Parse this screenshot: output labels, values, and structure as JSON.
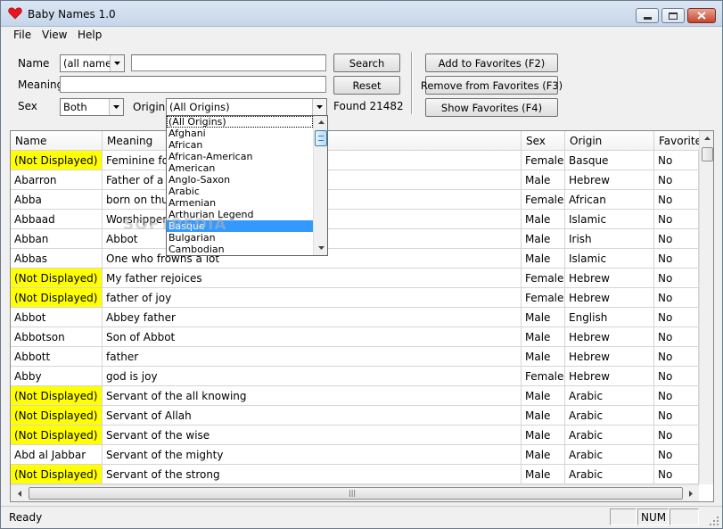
{
  "window": {
    "title": "Baby Names 1.0"
  },
  "menu": {
    "file": "File",
    "view": "View",
    "help": "Help"
  },
  "search": {
    "name_label": "Name",
    "name_mode": "(all names)",
    "name_value": "",
    "meaning_label": "Meaning",
    "meaning_value": "",
    "sex_label": "Sex",
    "sex_value": "Both",
    "origin_label": "Origin",
    "origin_value": "(All Origins)",
    "found_text": "Found 21482",
    "search_button": "Search",
    "reset_button": "Reset"
  },
  "favorites": {
    "add_button": "Add to Favorites (F2)",
    "remove_button": "Remove from Favorites (F3)",
    "show_button": "Show Favorites (F4)"
  },
  "origin_dropdown": {
    "items": [
      "(All Origins)",
      "Afghani",
      "African",
      "African-American",
      "American",
      "Anglo-Saxon",
      "Arabic",
      "Armenian",
      "Arthurian Legend",
      "Basque",
      "Bulgarian",
      "Cambodian"
    ],
    "selected": "Basque"
  },
  "table": {
    "columns": [
      "Name",
      "Meaning",
      "Sex",
      "Origin",
      "Favorite"
    ],
    "rows": [
      {
        "name": "(Not Displayed)",
        "meaning": "Feminine for",
        "sex": "Female",
        "origin": "Basque",
        "favorite": "No",
        "highlight": true
      },
      {
        "name": "Abarron",
        "meaning": "Father of a m",
        "sex": "Male",
        "origin": "Hebrew",
        "favorite": "No",
        "highlight": false
      },
      {
        "name": "Abba",
        "meaning": "born on thurs",
        "sex": "Female",
        "origin": "African",
        "favorite": "No",
        "highlight": false
      },
      {
        "name": "Abbaad",
        "meaning": "Worshipper",
        "sex": "Male",
        "origin": "Islamic",
        "favorite": "No",
        "highlight": false
      },
      {
        "name": "Abban",
        "meaning": "Abbot",
        "sex": "Male",
        "origin": "Irish",
        "favorite": "No",
        "highlight": false
      },
      {
        "name": "Abbas",
        "meaning": "One who frowns a lot",
        "sex": "Male",
        "origin": "Islamic",
        "favorite": "No",
        "highlight": false
      },
      {
        "name": "(Not Displayed)",
        "meaning": "My father rejoices",
        "sex": "Female",
        "origin": "Hebrew",
        "favorite": "No",
        "highlight": true
      },
      {
        "name": "(Not Displayed)",
        "meaning": "father of joy",
        "sex": "Female",
        "origin": "Hebrew",
        "favorite": "No",
        "highlight": true
      },
      {
        "name": "Abbot",
        "meaning": "Abbey father",
        "sex": "Male",
        "origin": "English",
        "favorite": "No",
        "highlight": false
      },
      {
        "name": "Abbotson",
        "meaning": "Son of Abbot",
        "sex": "Male",
        "origin": "Hebrew",
        "favorite": "No",
        "highlight": false
      },
      {
        "name": "Abbott",
        "meaning": "father",
        "sex": "Male",
        "origin": "Hebrew",
        "favorite": "No",
        "highlight": false
      },
      {
        "name": "Abby",
        "meaning": "god is joy",
        "sex": "Female",
        "origin": "Hebrew",
        "favorite": "No",
        "highlight": false
      },
      {
        "name": "(Not Displayed)",
        "meaning": "Servant of the all knowing",
        "sex": "Male",
        "origin": "Arabic",
        "favorite": "No",
        "highlight": true
      },
      {
        "name": "(Not Displayed)",
        "meaning": "Servant of Allah",
        "sex": "Male",
        "origin": "Arabic",
        "favorite": "No",
        "highlight": true
      },
      {
        "name": "(Not Displayed)",
        "meaning": "Servant of the wise",
        "sex": "Male",
        "origin": "Arabic",
        "favorite": "No",
        "highlight": true
      },
      {
        "name": "Abd al Jabbar",
        "meaning": "Servant of the mighty",
        "sex": "Male",
        "origin": "Arabic",
        "favorite": "No",
        "highlight": false
      },
      {
        "name": "(Not Displayed)",
        "meaning": "Servant of the strong",
        "sex": "Male",
        "origin": "Arabic",
        "favorite": "No",
        "highlight": true
      }
    ]
  },
  "status": {
    "text": "Ready",
    "num": "NUM"
  },
  "watermark": "SOFTPEDIA",
  "colors": {
    "highlight": "#ffff00",
    "selection": "#3399ff",
    "heart": "#e8141e"
  }
}
